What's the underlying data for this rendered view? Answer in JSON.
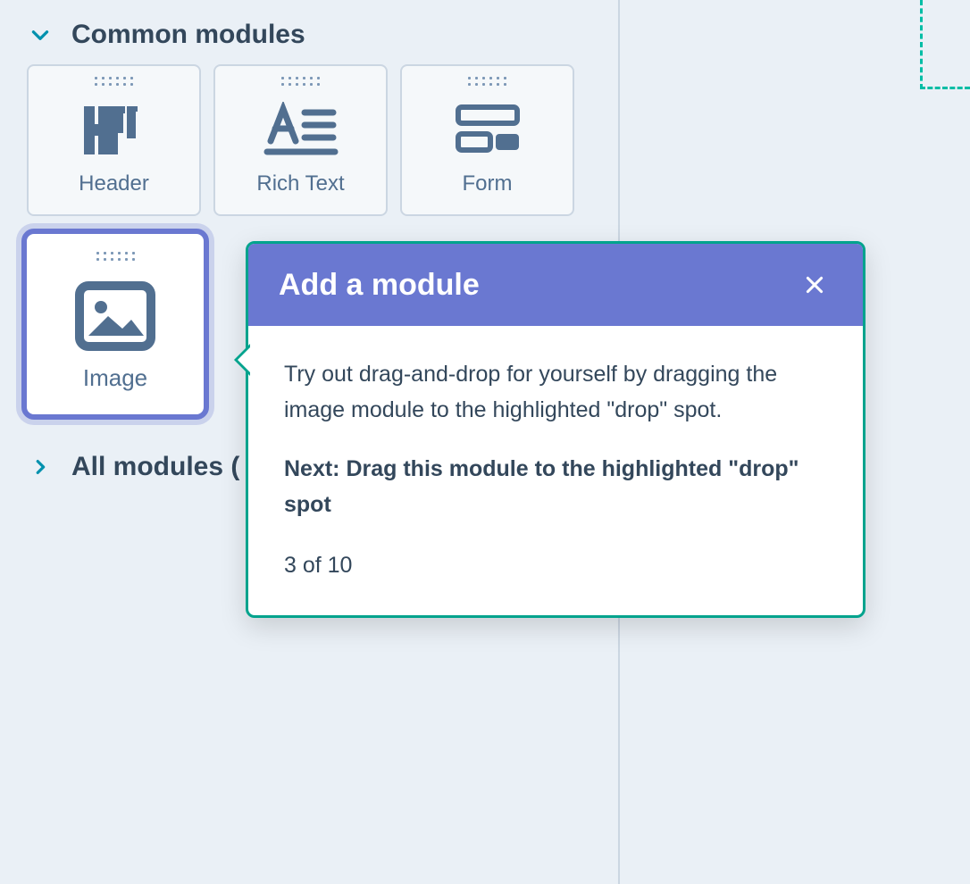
{
  "sections": {
    "common": {
      "title": "Common modules"
    },
    "all": {
      "title": "All modules ("
    }
  },
  "modules": {
    "row1": [
      {
        "label": "Header"
      },
      {
        "label": "Rich Text"
      },
      {
        "label": "Form"
      }
    ],
    "selected": {
      "label": "Image"
    }
  },
  "popover": {
    "title": "Add a module",
    "body": "Try out drag-and-drop for yourself by dragging the image module to the highlighted \"drop\" spot.",
    "next": "Next: Drag this module to the highlighted \"drop\" spot",
    "step": "3 of 10"
  },
  "colors": {
    "accent_purple": "#6a78d1",
    "accent_teal": "#00a38d",
    "icon_slate": "#516f90"
  }
}
